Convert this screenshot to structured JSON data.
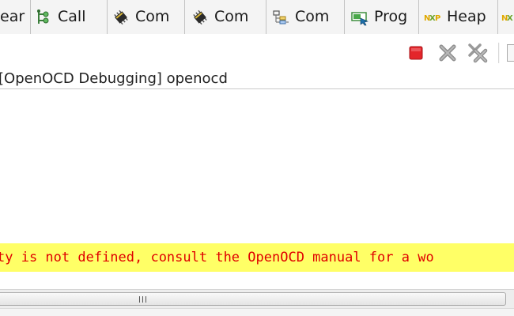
{
  "tabs": [
    {
      "label": "ear",
      "icon": "none"
    },
    {
      "label": "Call",
      "icon": "call-hierarchy-icon"
    },
    {
      "label": "Com",
      "icon": "chip-icon"
    },
    {
      "label": "Com",
      "icon": "chip-icon"
    },
    {
      "label": "Com",
      "icon": "hierarchy-icon"
    },
    {
      "label": "Prog",
      "icon": "progress-icon"
    },
    {
      "label": "Heap",
      "icon": "nxp-logo-icon"
    },
    {
      "label": "",
      "icon": "nxp-logo-icon"
    }
  ],
  "toolbar": {
    "terminate": "terminate-icon",
    "remove": "remove-launch-icon",
    "remove_all": "remove-all-terminated-icon"
  },
  "console": {
    "title": "[OpenOCD Debugging] openocd",
    "warning_line": "ty is not defined, consult the OpenOCD manual for a wo"
  },
  "colors": {
    "warning_bg": "#ffff66",
    "warning_text": "#e00000",
    "terminate": "#e4252a"
  }
}
